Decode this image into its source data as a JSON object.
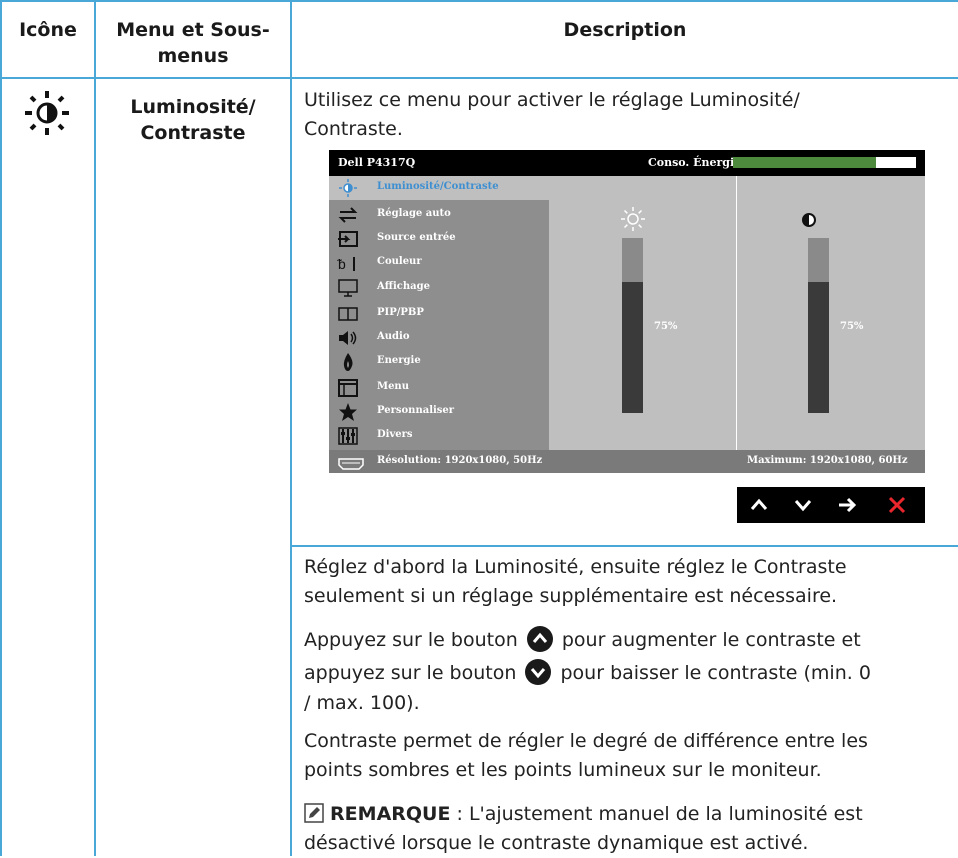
{
  "table": {
    "header": {
      "icon_col": "Icône",
      "menu_col_line1": "Menu et Sous-",
      "menu_col_line2": "menus",
      "desc_col": "Description"
    },
    "row": {
      "menu_line1": "Luminosité/",
      "menu_line2": "Contraste",
      "intro_line1": "Utilisez ce menu pour activer le réglage Luminosité/",
      "intro_line2": "Contraste."
    }
  },
  "osd": {
    "model": "Dell P4317Q",
    "energy_label": "Conso. Énergie",
    "energy_level": 0.78,
    "menu_items": [
      {
        "label": "Luminosité/Contraste",
        "icon": "brightness-contrast-icon",
        "selected": true
      },
      {
        "label": "Réglage auto",
        "icon": "auto-adjust-icon"
      },
      {
        "label": "Source entrée",
        "icon": "input-source-icon"
      },
      {
        "label": "Couleur",
        "icon": "color-icon"
      },
      {
        "label": "Affichage",
        "icon": "display-icon"
      },
      {
        "label": "PIP/PBP",
        "icon": "pip-pbp-icon"
      },
      {
        "label": "Audio",
        "icon": "audio-icon"
      },
      {
        "label": "Energie",
        "icon": "energy-icon"
      },
      {
        "label": "Menu",
        "icon": "menu-icon"
      },
      {
        "label": "Personnaliser",
        "icon": "star-icon"
      },
      {
        "label": "Divers",
        "icon": "misc-icon"
      }
    ],
    "brightness": {
      "value": 0.75,
      "label": "75%",
      "icon": "sun-icon"
    },
    "contrast": {
      "value": 0.75,
      "label": "75%",
      "icon": "contrast-icon"
    },
    "resolution": "Résolution: 1920x1080, 50Hz",
    "maximum": "Maximum: 1920x1080, 60Hz",
    "nav_buttons": [
      "up-arrow-icon",
      "down-arrow-icon",
      "right-arrow-icon",
      "close-icon"
    ],
    "nav_colors": {
      "arrows": "#ffffff",
      "close": "#e8262c"
    }
  },
  "body": {
    "p1_line1": "Réglez d'abord la Luminosité, ensuite réglez le Contraste",
    "p1_line2": "seulement si un réglage supplémentaire est nécessaire.",
    "p2_line1_a": "Appuyez sur le bouton",
    "p2_line1_b": "pour augmenter le contraste et",
    "p2_line2_a": "appuyez sur le bouton",
    "p2_line2_b": "pour baisser le contraste (min. 0",
    "p2_line3": "/ max. 100).",
    "p3_line1": "Contraste permet de régler le degré de différence entre les",
    "p3_line2": "points sombres et les points lumineux sur le moniteur.",
    "note_title": "REMARQUE",
    "note_line1_rest": " : L'ajustement manuel de la luminosité est",
    "note_line2": "désactivé lorsque le contraste dynamique est activé."
  },
  "colors": {
    "table_border": "#4aa8d8",
    "selected_text": "#3d8fd1",
    "energy_green": "#4e8a3e"
  }
}
